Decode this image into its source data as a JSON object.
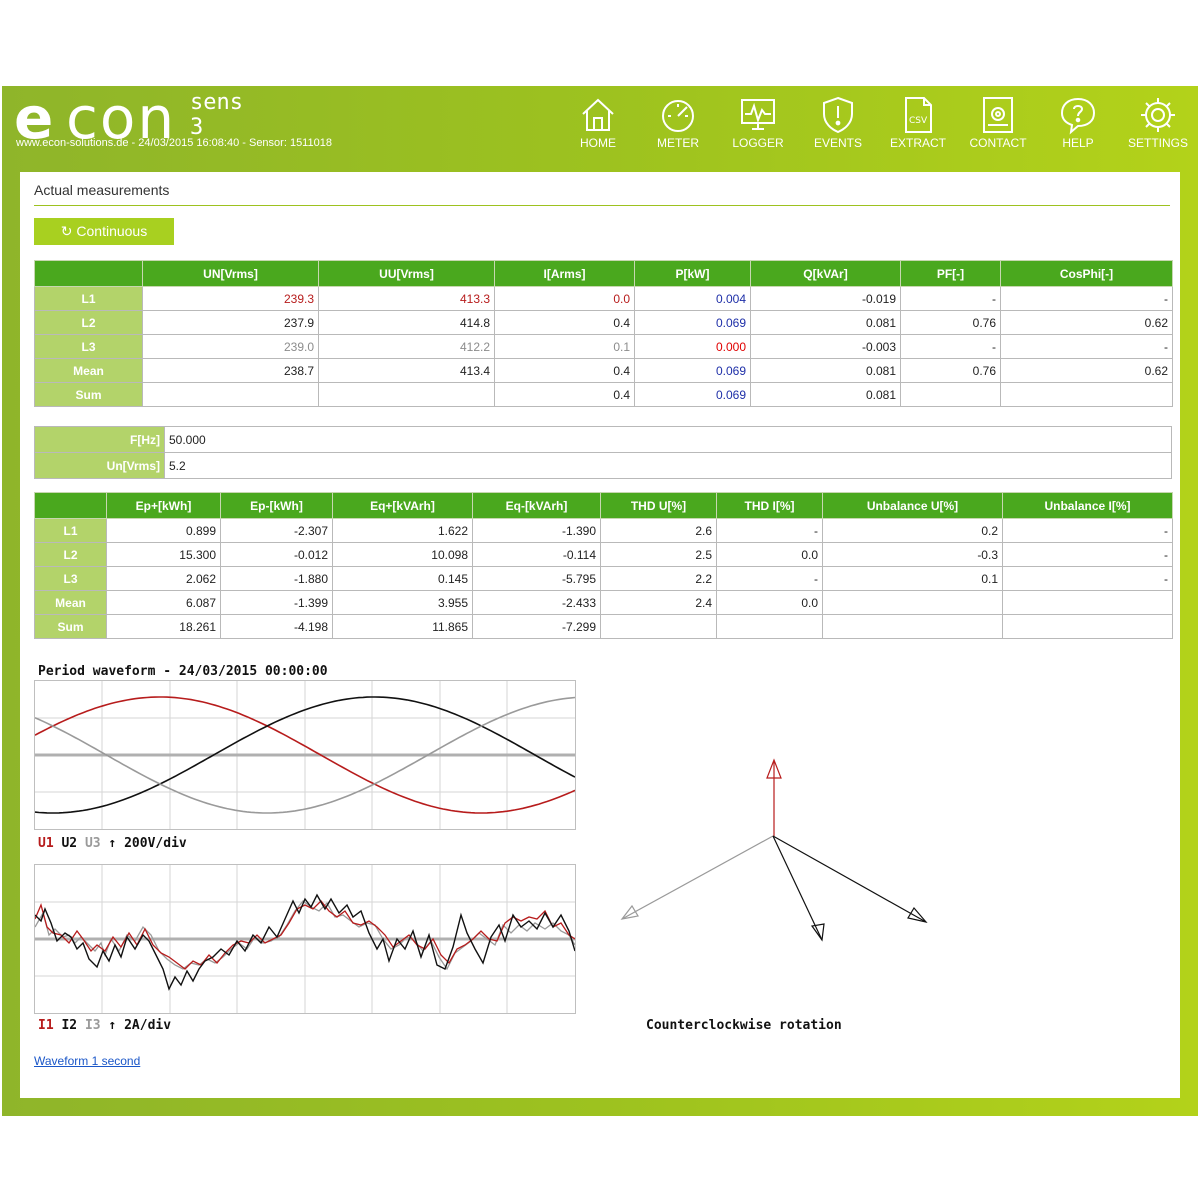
{
  "header": {
    "logo_e": "e",
    "logo_con": "con",
    "logo_sens": "sens 3",
    "site_info": "www.econ-solutions.de - 24/03/2015 16:08:40 - Sensor: 1511018",
    "nav": [
      {
        "label": "HOME",
        "icon": "home-icon"
      },
      {
        "label": "METER",
        "icon": "gauge-icon"
      },
      {
        "label": "LOGGER",
        "icon": "monitor-icon"
      },
      {
        "label": "EVENTS",
        "icon": "shield-alert-icon"
      },
      {
        "label": "EXTRACT",
        "icon": "csv-file-icon"
      },
      {
        "label": "CONTACT",
        "icon": "contact-book-icon"
      },
      {
        "label": "HELP",
        "icon": "help-bubble-icon"
      },
      {
        "label": "SETTINGS",
        "icon": "gear-icon"
      }
    ]
  },
  "main": {
    "title": "Actual measurements",
    "continuous_button": "↻ Continuous"
  },
  "table1": {
    "headers": [
      "UN[Vrms]",
      "UU[Vrms]",
      "I[Arms]",
      "P[kW]",
      "Q[kVAr]",
      "PF[-]",
      "CosPhi[-]"
    ],
    "rows": [
      {
        "label": "L1",
        "cells": [
          "239.3",
          "413.3",
          "0.0",
          "0.004",
          "-0.019",
          "-",
          "-"
        ]
      },
      {
        "label": "L2",
        "cells": [
          "237.9",
          "414.8",
          "0.4",
          "0.069",
          "0.081",
          "0.76",
          "0.62"
        ]
      },
      {
        "label": "L3",
        "cells": [
          "239.0",
          "412.2",
          "0.1",
          "0.000",
          "-0.003",
          "-",
          "-"
        ]
      },
      {
        "label": "Mean",
        "cells": [
          "238.7",
          "413.4",
          "0.4",
          "0.069",
          "0.081",
          "0.76",
          "0.62"
        ]
      },
      {
        "label": "Sum",
        "cells": [
          "",
          "",
          "0.4",
          "0.069",
          "0.081",
          "",
          ""
        ]
      }
    ]
  },
  "freq": {
    "f_label": "F[Hz]",
    "f_value": "50.000",
    "un_label": "Un[Vrms]",
    "un_value": "5.2"
  },
  "table2": {
    "headers": [
      "Ep+[kWh]",
      "Ep-[kWh]",
      "Eq+[kVArh]",
      "Eq-[kVArh]",
      "THD U[%]",
      "THD I[%]",
      "Unbalance U[%]",
      "Unbalance I[%]"
    ],
    "rows": [
      {
        "label": "L1",
        "cells": [
          "0.899",
          "-2.307",
          "1.622",
          "-1.390",
          "2.6",
          "-",
          "0.2",
          "-"
        ]
      },
      {
        "label": "L2",
        "cells": [
          "15.300",
          "-0.012",
          "10.098",
          "-0.114",
          "2.5",
          "0.0",
          "-0.3",
          "-"
        ]
      },
      {
        "label": "L3",
        "cells": [
          "2.062",
          "-1.880",
          "0.145",
          "-5.795",
          "2.2",
          "-",
          "0.1",
          "-"
        ]
      },
      {
        "label": "Mean",
        "cells": [
          "6.087",
          "-1.399",
          "3.955",
          "-2.433",
          "2.4",
          "0.0",
          "",
          ""
        ]
      },
      {
        "label": "Sum",
        "cells": [
          "18.261",
          "-4.198",
          "11.865",
          "-7.299",
          "",
          "",
          "",
          ""
        ]
      }
    ]
  },
  "waveform": {
    "title": "Period waveform - 24/03/2015 00:00:00",
    "u_legend": {
      "l1": "U1",
      "l2": "U2",
      "l3": "U3",
      "scale": "↑ 200V/div"
    },
    "i_legend": {
      "l1": "I1",
      "l2": "I2",
      "l3": "I3",
      "scale": "↑ 2A/div"
    },
    "colors": {
      "phase1": "#b71c1c",
      "phase2": "#111111",
      "phase3": "#9a9a9a"
    }
  },
  "phasor": {
    "rotation_label": "Counterclockwise rotation"
  },
  "links": {
    "waveform_1s": "Waveform 1 second"
  }
}
